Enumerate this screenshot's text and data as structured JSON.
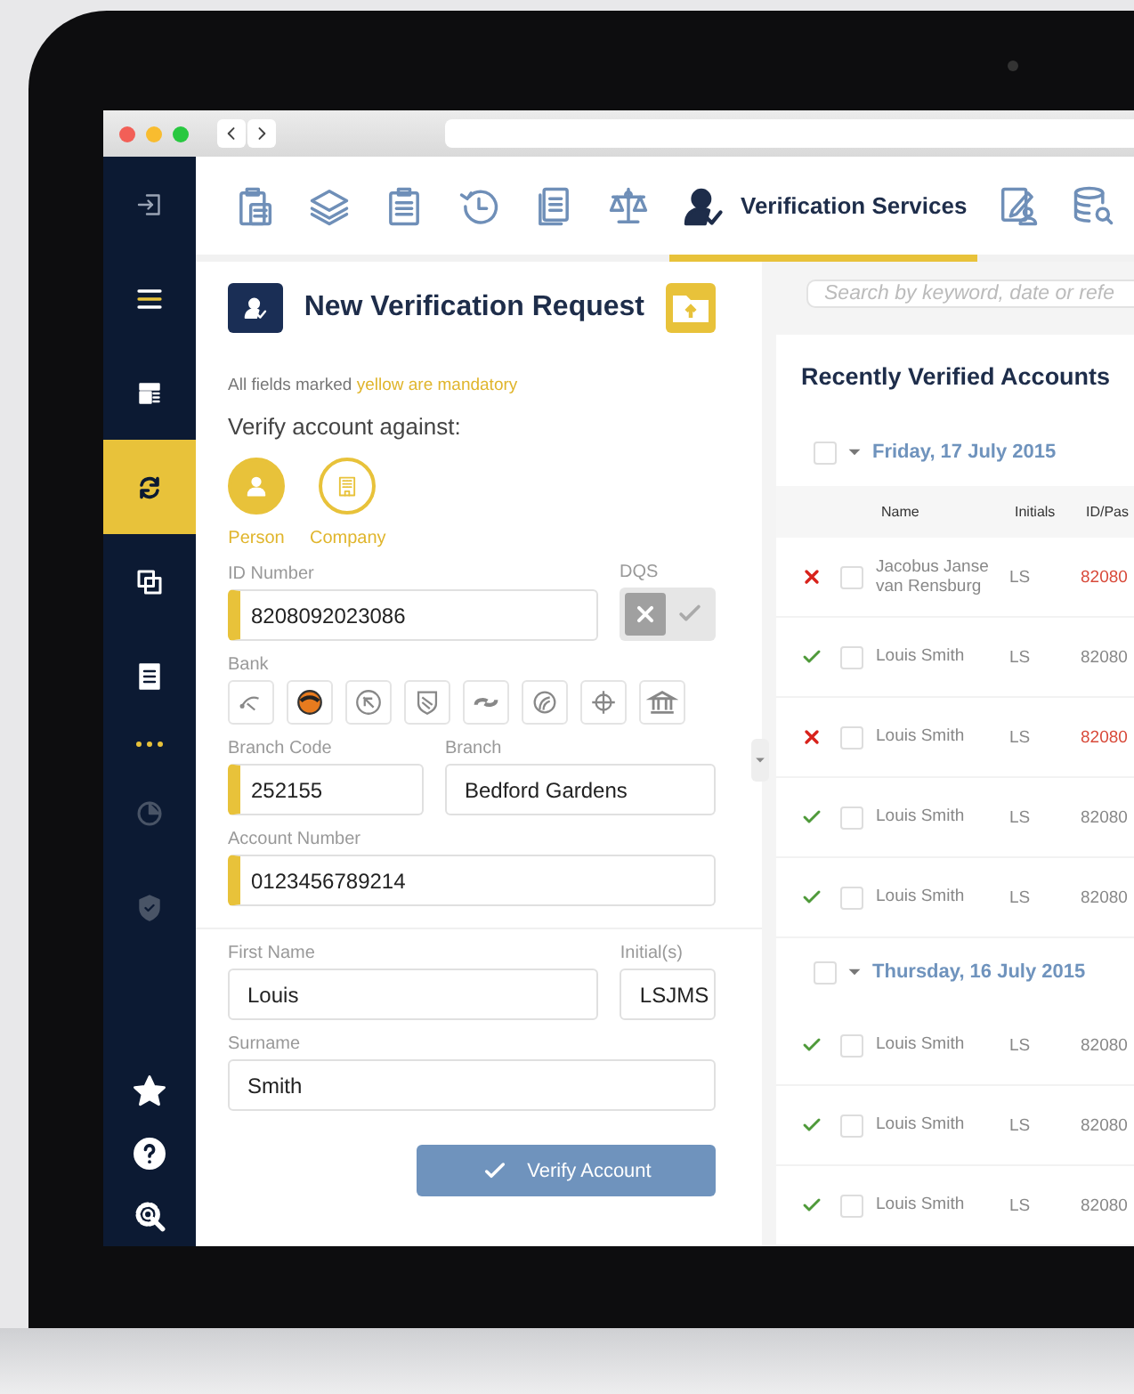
{
  "sidebar": {
    "items": [
      {
        "selected": false,
        "disabled": false
      },
      {
        "selected": false,
        "disabled": false
      },
      {
        "selected": false,
        "disabled": false
      },
      {
        "selected": true,
        "disabled": false
      },
      {
        "selected": false,
        "disabled": false
      },
      {
        "selected": false,
        "disabled": false
      },
      {
        "selected": false,
        "disabled": false
      },
      {
        "selected": false,
        "disabled": true
      },
      {
        "selected": false,
        "disabled": true
      }
    ],
    "bottom_items": [
      {
        "selected": false,
        "disabled": false
      },
      {
        "selected": false,
        "disabled": false
      },
      {
        "selected": false,
        "disabled": false
      }
    ]
  },
  "toolbar": {
    "tabs": [
      {
        "selected": false
      },
      {
        "selected": false
      },
      {
        "selected": false
      },
      {
        "selected": false
      },
      {
        "selected": false
      },
      {
        "selected": false
      },
      {
        "label": "Verification Services",
        "selected": true
      },
      {
        "selected": false
      },
      {
        "selected": false
      }
    ]
  },
  "form": {
    "title": "New Verification Request",
    "note": "All fields marked",
    "note_highlight": "yellow are mandatory",
    "verify_label": "Verify account against:",
    "options": [
      {
        "label": "Person",
        "selected": true
      },
      {
        "label": "Company",
        "selected": false
      }
    ],
    "id_number": {
      "label": "ID Number",
      "value": "8208092023086",
      "mandatory": true
    },
    "dqs": {
      "label": "DQS",
      "on": false
    },
    "bank": {
      "label": "Bank"
    },
    "branch_code": {
      "label": "Branch Code",
      "value": "252155",
      "mandatory": true
    },
    "branch": {
      "label": "Branch",
      "value": "Bedford Gardens",
      "mandatory": false
    },
    "account_number": {
      "label": "Account Number",
      "value": "0123456789214",
      "mandatory": true
    },
    "first_name": {
      "label": "First Name",
      "value": "Louis",
      "mandatory": false
    },
    "initials": {
      "label": "Initial(s)",
      "value": "LSJMS",
      "mandatory": false
    },
    "surname": {
      "label": "Surname",
      "value": "Smith",
      "mandatory": false
    },
    "submit": "Verify Account"
  },
  "results": {
    "search": {
      "placeholder": "Search by keyword, date or refe"
    },
    "title": "Recently Verified Accounts",
    "columns": [
      "Name",
      "Initials",
      "ID/Pas"
    ],
    "groups": [
      {
        "date": "Friday, 17 July 2015",
        "checked": false,
        "expanded": true,
        "rows": [
          {
            "verified": false,
            "checked": false,
            "name": "Jacobus Janse van Rensburg",
            "initials": "LS",
            "id_number": "82080"
          },
          {
            "verified": true,
            "checked": false,
            "name": "Louis Smith",
            "initials": "LS",
            "id_number": "82080"
          },
          {
            "verified": false,
            "checked": false,
            "name": "Louis Smith",
            "initials": "LS",
            "id_number": "82080"
          },
          {
            "verified": true,
            "checked": false,
            "name": "Louis Smith",
            "initials": "LS",
            "id_number": "82080"
          },
          {
            "verified": true,
            "checked": false,
            "name": "Louis Smith",
            "initials": "LS",
            "id_number": "82080"
          }
        ]
      },
      {
        "date": "Thursday, 16 July 2015",
        "checked": false,
        "expanded": true,
        "rows": [
          {
            "verified": true,
            "checked": false,
            "name": "Louis Smith",
            "initials": "LS",
            "id_number": "82080"
          },
          {
            "verified": true,
            "checked": false,
            "name": "Louis Smith",
            "initials": "LS",
            "id_number": "82080"
          },
          {
            "verified": true,
            "checked": false,
            "name": "Louis Smith",
            "initials": "LS",
            "id_number": "82080"
          }
        ]
      }
    ]
  }
}
